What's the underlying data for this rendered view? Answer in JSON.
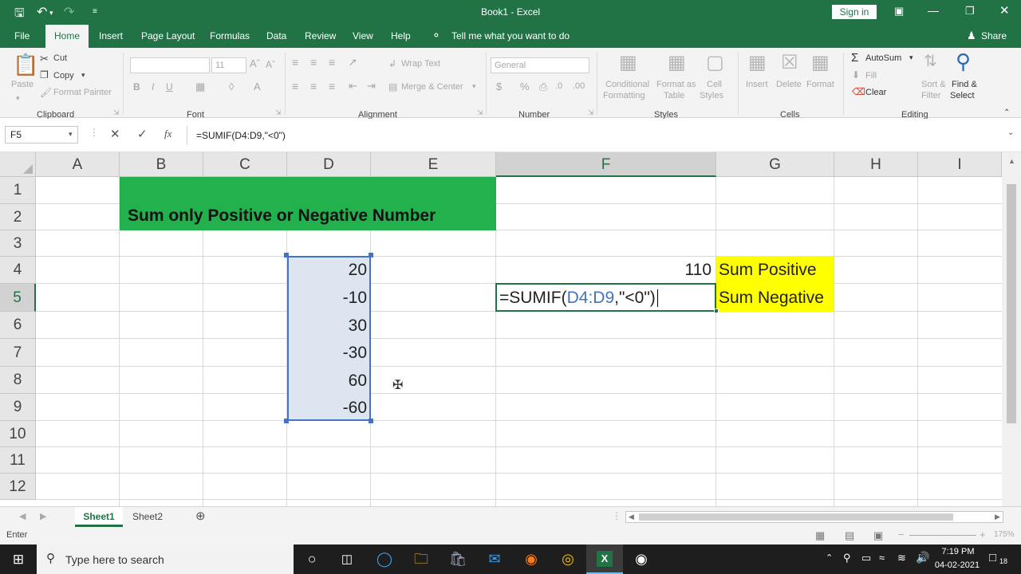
{
  "titlebar": {
    "title": "Book1  -  Excel",
    "sign_in": "Sign in",
    "save_icon": "save-icon",
    "undo_icon": "undo-icon",
    "redo_icon": "redo-icon"
  },
  "ribbon_tabs": [
    "File",
    "Home",
    "Insert",
    "Page Layout",
    "Formulas",
    "Data",
    "Review",
    "View",
    "Help"
  ],
  "tell_me": "Tell me what you want to do",
  "share": "Share",
  "ribbon": {
    "clipboard": {
      "paste": "Paste",
      "cut": "Cut",
      "copy": "Copy",
      "format_painter": "Format Painter",
      "group": "Clipboard"
    },
    "font": {
      "font_size": "11",
      "group": "Font"
    },
    "alignment": {
      "wrap_text": "Wrap Text",
      "merge_center": "Merge & Center",
      "group": "Alignment"
    },
    "number": {
      "format": "General",
      "group": "Number"
    },
    "styles": {
      "conditional": "Conditional",
      "formatting": "Formatting",
      "format_as": "Format as",
      "table": "Table",
      "cell": "Cell",
      "cell_styles": "Styles",
      "group": "Styles"
    },
    "cells": {
      "insert": "Insert",
      "delete": "Delete",
      "format": "Format",
      "group": "Cells"
    },
    "editing": {
      "autosum": "AutoSum",
      "fill": "Fill",
      "clear": "Clear",
      "sort": "Sort &",
      "filter": "Filter",
      "find": "Find &",
      "select": "Select",
      "group": "Editing"
    }
  },
  "formula_bar": {
    "name_box": "F5",
    "formula": "=SUMIF(D4:D9,\"<0\")"
  },
  "columns": [
    "A",
    "B",
    "C",
    "D",
    "E",
    "F",
    "G",
    "H",
    "I"
  ],
  "rows": [
    "1",
    "2",
    "3",
    "4",
    "5",
    "6",
    "7",
    "8",
    "9",
    "10",
    "11",
    "12"
  ],
  "cells": {
    "title": "Sum only Positive or Negative Number",
    "d_values": [
      "20",
      "-10",
      "30",
      "-30",
      "60",
      "-60"
    ],
    "f4": "110",
    "g4": "Sum Positive",
    "g5": "Sum Negative",
    "edit_prefix": "=SUMIF(",
    "edit_ref": "D4:D9",
    "edit_suffix": ",\"<0\")"
  },
  "colors": {
    "excel_green": "#217346",
    "title_fill": "#22b14c",
    "label_fill": "#ffff00",
    "range_blue": "#4472c4"
  },
  "sheets": [
    "Sheet1",
    "Sheet2"
  ],
  "status": {
    "mode": "Enter",
    "zoom": "175%"
  },
  "taskbar": {
    "search_placeholder": "Type here to search",
    "time": "7:19 PM",
    "date": "04-02-2021",
    "notifications": "18"
  }
}
